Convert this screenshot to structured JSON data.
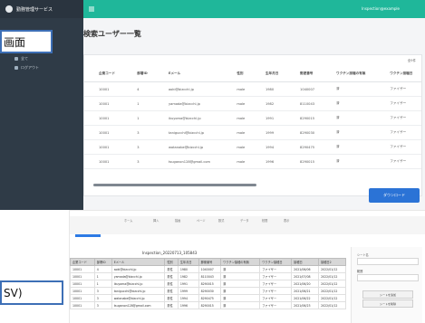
{
  "app": {
    "brand": "勤務管理サービス",
    "menu": [
      {
        "label": "全て"
      },
      {
        "label": "ログアウト"
      }
    ],
    "topbar_user": "Inspection@example",
    "page_title": "検索ユーザー一覧",
    "count_text": "全5件",
    "table": {
      "headers": [
        "企業コード",
        "部署ID",
        "Eメール",
        "性別",
        "生年月日",
        "郵便番号",
        "ワクチン接種の有無",
        "ワクチン接種日"
      ],
      "rows": [
        [
          "10001",
          "4",
          "aoki@bizcchl.jp",
          "male",
          "1980",
          "1040007",
          "済",
          "ファイザー"
        ],
        [
          "10001",
          "1",
          "yamada@bizcchl.jp",
          "male",
          "1982",
          "8110043",
          "済",
          "ファイザー"
        ],
        [
          "10001",
          "1",
          "ikuyoma@bizcchl.jp",
          "male",
          "1991",
          "8290015",
          "済",
          "ファイザー"
        ],
        [
          "10001",
          "3",
          "tanigucchi@bizcchl.jp",
          "male",
          "1999",
          "8290030",
          "済",
          "ファイザー"
        ],
        [
          "10001",
          "3",
          "watanabe@bizcchl.jp",
          "male",
          "1994",
          "8290475",
          "済",
          "ファイザー"
        ],
        [
          "10001",
          "3",
          "tsuganon128@gmail.com",
          "male",
          "1996",
          "8290015",
          "済",
          "ファイザー"
        ]
      ]
    },
    "download_label": "ダウンロード"
  },
  "callouts": {
    "top": "画面",
    "bottom": "SV)"
  },
  "excel": {
    "sheet_title": "Inspection_20220713_105843",
    "ribbon_tabs": [
      "ホーム",
      "挿入",
      "描画",
      "ページ",
      "数式",
      "データ",
      "校閲",
      "表示"
    ],
    "grid_headers": [
      "企業コード",
      "部署ID",
      "Eメール",
      "性別",
      "生年月日",
      "郵便番号",
      "ワクチン接種の有無",
      "ワクチン接種日",
      "接種日",
      "接種日2"
    ],
    "grid_rows": [
      [
        "10001",
        "4",
        "aoki@bizcchl.jp",
        "男性",
        "1980",
        "1040007",
        "済",
        "ファイザー",
        "2021/06/06",
        "2022/01/12"
      ],
      [
        "10001",
        "1",
        "yamada@bizcchl.jp",
        "男性",
        "1982",
        "8110043",
        "済",
        "ファイザー",
        "2021/07/08",
        "2022/01/12"
      ],
      [
        "10001",
        "1",
        "ikuyoma@bizcchl.jp",
        "男性",
        "1991",
        "8290015",
        "済",
        "ファイザー",
        "2021/06/20",
        "2022/01/12"
      ],
      [
        "10001",
        "3",
        "tanigucchi@bizcchl.jp",
        "男性",
        "1999",
        "8290030",
        "済",
        "ファイザー",
        "2021/06/21",
        "2022/01/12"
      ],
      [
        "10001",
        "3",
        "watanabe@bizcchl.jp",
        "男性",
        "1994",
        "8290475",
        "済",
        "ファイザー",
        "2021/06/22",
        "2022/01/12"
      ],
      [
        "10001",
        "3",
        "tsuganon128@gmail.com",
        "男性",
        "1996",
        "8290015",
        "済",
        "ファイザー",
        "2021/06/23",
        "2022/01/12"
      ]
    ],
    "panel": {
      "label_top": "シート名",
      "label_mid": "範囲",
      "btn1": "シートを追加",
      "btn2": "シートを削除"
    }
  },
  "colors": {
    "topbar": "#1fb79a",
    "sidebar": "#2f3b47",
    "download": "#2b73d6",
    "callout_border": "#3d6fb6"
  }
}
